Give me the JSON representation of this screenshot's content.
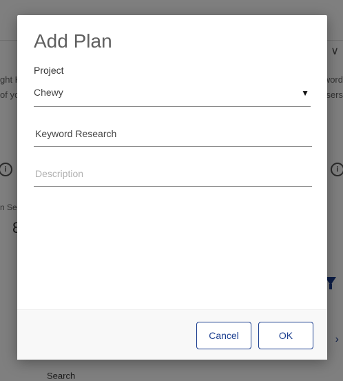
{
  "background": {
    "snippet_left_1": "ght K",
    "snippet_left_2": "of yo",
    "snippet_right_1": "word",
    "snippet_right_2": "sers",
    "stat_label": "n Sea",
    "stat_value": "8",
    "search_label": "Search"
  },
  "dialog": {
    "title": "Add Plan",
    "project_label": "Project",
    "project_value": "Chewy",
    "name_value": "Keyword Research",
    "description_placeholder": "Description",
    "cancel_label": "Cancel",
    "ok_label": "OK"
  },
  "colors": {
    "accent": "#1a3d8f"
  }
}
